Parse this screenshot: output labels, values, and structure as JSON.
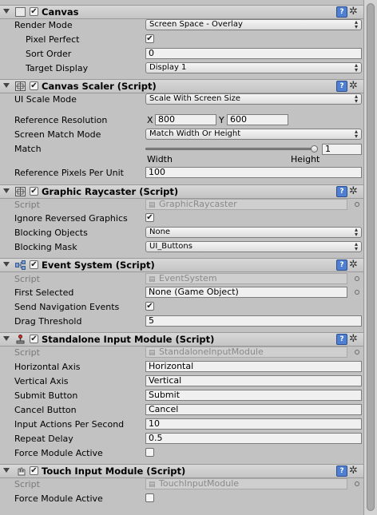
{
  "canvas": {
    "title": "Canvas",
    "render_mode_label": "Render Mode",
    "render_mode_value": "Screen Space - Overlay",
    "pixel_perfect_label": "Pixel Perfect",
    "pixel_perfect_checked": true,
    "sort_order_label": "Sort Order",
    "sort_order_value": "0",
    "target_display_label": "Target Display",
    "target_display_value": "Display 1"
  },
  "canvas_scaler": {
    "title": "Canvas Scaler (Script)",
    "ui_scale_mode_label": "UI Scale Mode",
    "ui_scale_mode_value": "Scale With Screen Size",
    "reference_resolution_label": "Reference Resolution",
    "x_label": "X",
    "x_value": "800",
    "y_label": "Y",
    "y_value": "600",
    "screen_match_mode_label": "Screen Match Mode",
    "screen_match_mode_value": "Match Width Or Height",
    "match_label": "Match",
    "match_value": "1",
    "match_fraction": 1,
    "width_label": "Width",
    "height_label": "Height",
    "reference_ppu_label": "Reference Pixels Per Unit",
    "reference_ppu_value": "100"
  },
  "graphic_raycaster": {
    "title": "Graphic Raycaster (Script)",
    "script_label": "Script",
    "script_value": "GraphicRaycaster",
    "ignore_reversed_label": "Ignore Reversed Graphics",
    "ignore_reversed_checked": true,
    "blocking_objects_label": "Blocking Objects",
    "blocking_objects_value": "None",
    "blocking_mask_label": "Blocking Mask",
    "blocking_mask_value": "UI_Buttons"
  },
  "event_system": {
    "title": "Event System (Script)",
    "script_label": "Script",
    "script_value": "EventSystem",
    "first_selected_label": "First Selected",
    "first_selected_value": "None (Game Object)",
    "send_nav_label": "Send Navigation Events",
    "send_nav_checked": true,
    "drag_threshold_label": "Drag Threshold",
    "drag_threshold_value": "5"
  },
  "standalone_input": {
    "title": "Standalone Input Module (Script)",
    "script_label": "Script",
    "script_value": "StandaloneInputModule",
    "horizontal_axis_label": "Horizontal Axis",
    "horizontal_axis_value": "Horizontal",
    "vertical_axis_label": "Vertical Axis",
    "vertical_axis_value": "Vertical",
    "submit_button_label": "Submit Button",
    "submit_button_value": "Submit",
    "cancel_button_label": "Cancel Button",
    "cancel_button_value": "Cancel",
    "input_aps_label": "Input Actions Per Second",
    "input_aps_value": "10",
    "repeat_delay_label": "Repeat Delay",
    "repeat_delay_value": "0.5",
    "force_active_label": "Force Module Active",
    "force_active_checked": false
  },
  "touch_input": {
    "title": "Touch Input Module (Script)",
    "script_label": "Script",
    "script_value": "TouchInputModule",
    "force_active_label": "Force Module Active",
    "force_active_checked": false
  },
  "icons": {
    "help": "help-icon",
    "gear": "gear-icon",
    "script": "script-icon"
  },
  "colors": {
    "panel_bg": "#c2c2c2",
    "help_blue": "#4f7fd1"
  }
}
